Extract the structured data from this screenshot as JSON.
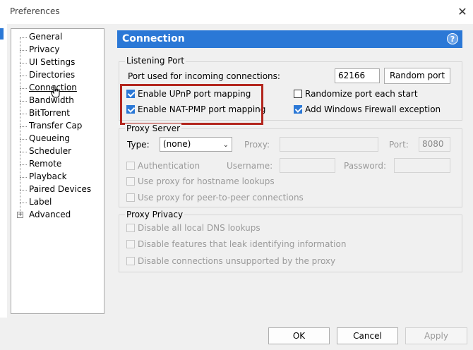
{
  "window": {
    "title": "Preferences",
    "close_glyph": "✕"
  },
  "tree": {
    "items": [
      "General",
      "Privacy",
      "UI Settings",
      "Directories",
      "Connection",
      "Bandwidth",
      "BitTorrent",
      "Transfer Cap",
      "Queueing",
      "Scheduler",
      "Remote",
      "Playback",
      "Paired Devices",
      "Label",
      "Advanced"
    ],
    "selected": "Connection"
  },
  "panel": {
    "title": "Connection",
    "help_glyph": "?"
  },
  "listening_port": {
    "group_label": "Listening Port",
    "port_label": "Port used for incoming connections:",
    "port_value": "62166",
    "random_port_button": "Random port",
    "upnp_label": "Enable UPnP port mapping",
    "upnp_checked": true,
    "natpmp_label": "Enable NAT-PMP port mapping",
    "natpmp_checked": true,
    "randomize_label": "Randomize port each start",
    "randomize_checked": false,
    "firewall_label": "Add Windows Firewall exception",
    "firewall_checked": true
  },
  "proxy_server": {
    "group_label": "Proxy Server",
    "type_label": "Type:",
    "type_value": "(none)",
    "proxy_label": "Proxy:",
    "port_label": "Port:",
    "port_value": "8080",
    "auth_label": "Authentication",
    "username_label": "Username:",
    "password_label": "Password:",
    "hostname_label": "Use proxy for hostname lookups",
    "p2p_label": "Use proxy for peer-to-peer connections"
  },
  "proxy_privacy": {
    "group_label": "Proxy Privacy",
    "dns_label": "Disable all local DNS lookups",
    "leak_label": "Disable features that leak identifying information",
    "unsupported_label": "Disable connections unsupported by the proxy"
  },
  "buttons": {
    "ok": "OK",
    "cancel": "Cancel",
    "apply": "Apply"
  },
  "colors": {
    "accent": "#2b78d6",
    "highlight": "#b3261e"
  }
}
